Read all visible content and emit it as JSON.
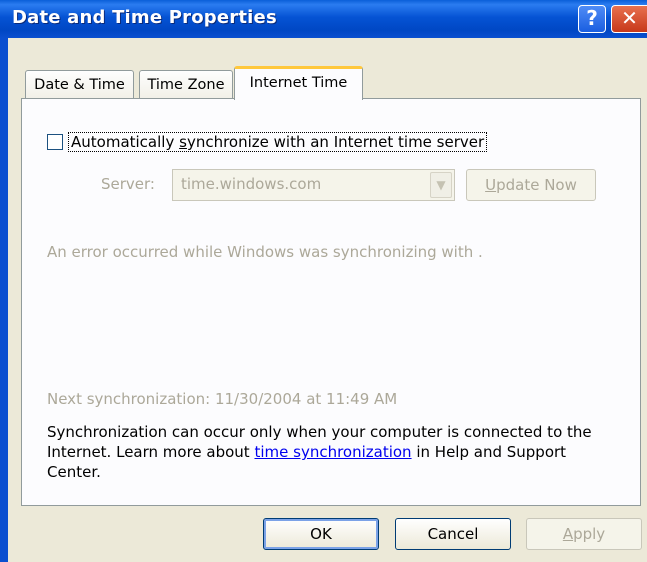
{
  "window": {
    "title": "Date and Time Properties",
    "help_glyph": "?",
    "close_glyph": "✕"
  },
  "tabs": [
    {
      "label": "Date & Time",
      "active": false
    },
    {
      "label": "Time Zone",
      "active": false
    },
    {
      "label": "Internet Time",
      "active": true
    }
  ],
  "internet_time": {
    "auto_sync_label_pre": "Automatically ",
    "auto_sync_label_acc": "s",
    "auto_sync_label_post": "ynchronize with an Internet time server",
    "auto_sync_checked": false,
    "server_label": "Server:",
    "server_value": "time.windows.com",
    "update_now_acc": "U",
    "update_now_rest": "pdate Now",
    "error_message": "An error occurred while Windows was synchronizing with .",
    "next_sync": "Next synchronization: 11/30/2004 at 11:49 AM",
    "info_pre": "Synchronization can occur only when your computer is connected to the Internet.  Learn more about ",
    "info_link": "time synchronization",
    "info_post": " in Help and Support Center."
  },
  "buttons": {
    "ok": "OK",
    "cancel": "Cancel",
    "apply_acc": "A",
    "apply_rest": "pply"
  },
  "colors": {
    "titlebar": "#0a4fd0",
    "active_tab_highlight": "#ffc83c",
    "disabled_text": "#aca899",
    "link": "#0000ee"
  }
}
